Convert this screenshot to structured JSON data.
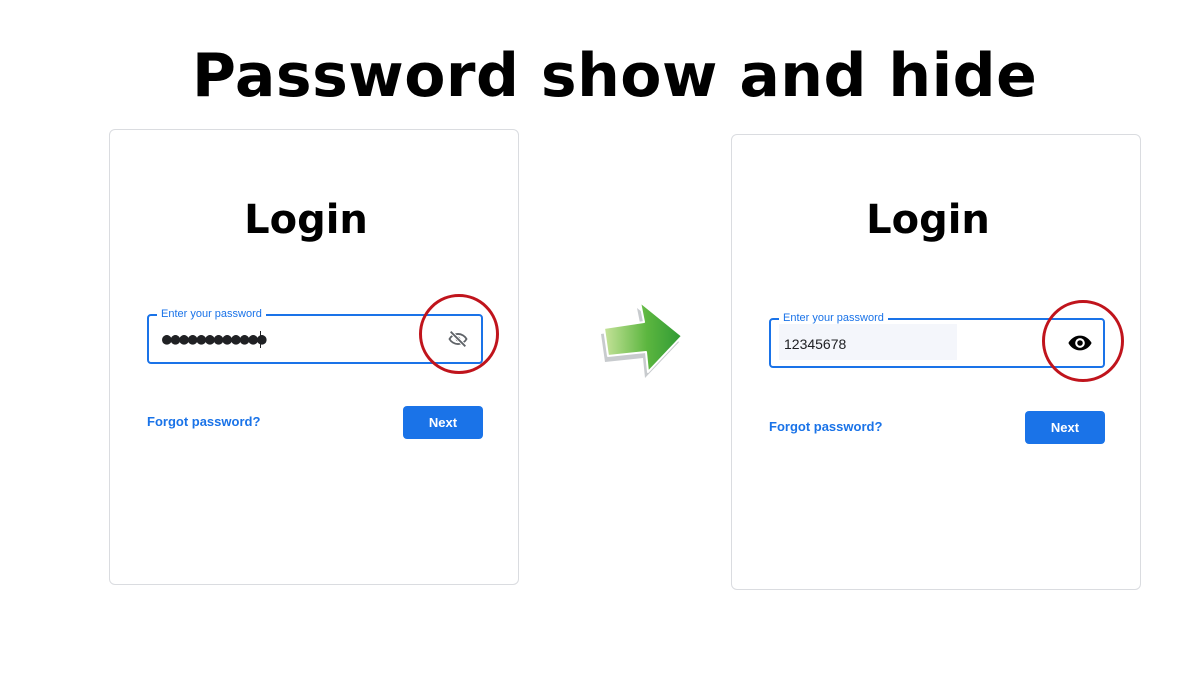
{
  "headline": "Password show and hide",
  "before_panel": {
    "title": "Login",
    "password_label": "Enter your password",
    "password_value": "●●●●●●●●●●●●",
    "toggle_icon": "eye-slash-icon",
    "forgot_link": "Forgot password?",
    "next_button": "Next"
  },
  "after_panel": {
    "title": "Login",
    "password_label": "Enter your password",
    "password_value": "12345678",
    "toggle_icon": "eye-icon",
    "forgot_link": "Forgot password?",
    "next_button": "Next"
  },
  "transition_icon": "green-arrow-right-icon",
  "colors": {
    "accent_blue": "#1a73e8",
    "highlight_red": "#c0141c",
    "arrow_green": "#3ca33c"
  }
}
